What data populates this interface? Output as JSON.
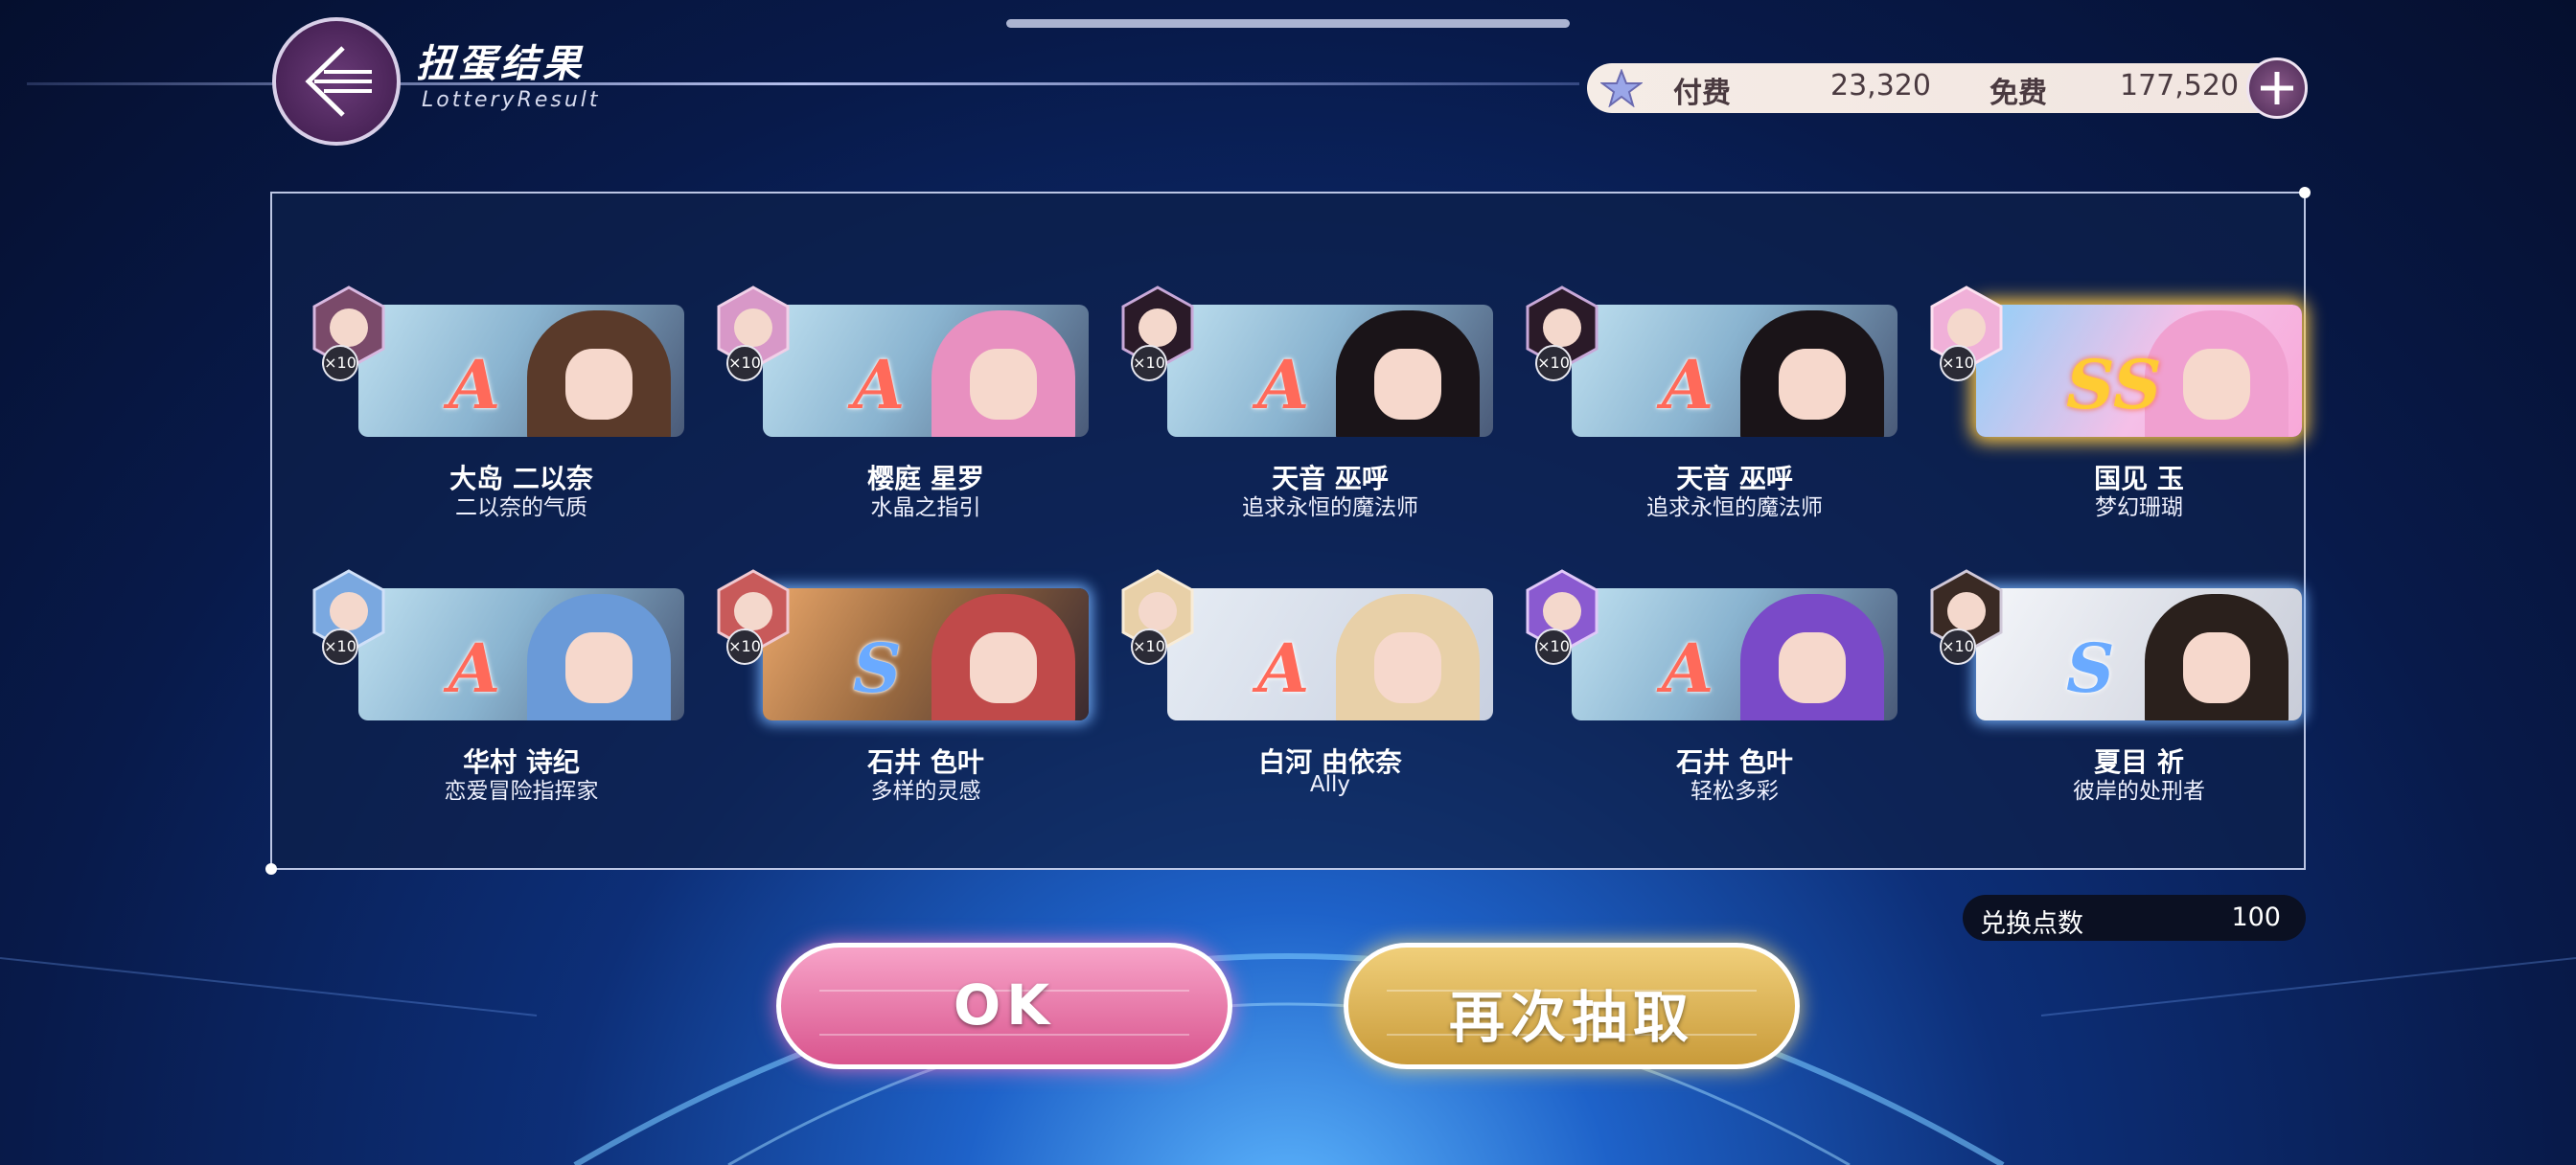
{
  "header": {
    "title": "扭蛋结果",
    "subtitle": "LotteryResult"
  },
  "currency": {
    "paid_label": "付费",
    "paid_value": "23,320",
    "free_label": "免费",
    "free_value": "177,520"
  },
  "results": [
    {
      "name": "大岛 二以奈",
      "title": "二以奈的气质",
      "rank": "A",
      "count": "×10"
    },
    {
      "name": "樱庭 星罗",
      "title": "水晶之指引",
      "rank": "A",
      "count": "×10"
    },
    {
      "name": "天音 巫呼",
      "title": "追求永恒的魔法师",
      "rank": "A",
      "count": "×10"
    },
    {
      "name": "天音 巫呼",
      "title": "追求永恒的魔法师",
      "rank": "A",
      "count": "×10"
    },
    {
      "name": "国见 玉",
      "title": "梦幻珊瑚",
      "rank": "SS",
      "count": "×10"
    },
    {
      "name": "华村 诗纪",
      "title": "恋爱冒险指挥家",
      "rank": "A",
      "count": "×10"
    },
    {
      "name": "石井 色叶",
      "title": "多样的灵感",
      "rank": "S",
      "count": "×10"
    },
    {
      "name": "白河 由依奈",
      "title": "Ally",
      "rank": "A",
      "count": "×10"
    },
    {
      "name": "石井 色叶",
      "title": "轻松多彩",
      "rank": "A",
      "count": "×10"
    },
    {
      "name": "夏目 祈",
      "title": "彼岸的处刑者",
      "rank": "S",
      "count": "×10"
    }
  ],
  "exchange": {
    "label": "兑换点数",
    "value": "100"
  },
  "buttons": {
    "ok": "OK",
    "again": "再次抽取"
  },
  "colors": {
    "rank_a": "#ff6a5a",
    "rank_s": "#6aaaff",
    "rank_ss": "#ffcc33",
    "ok_button": "#e46ea3",
    "again_button": "#d9b155"
  },
  "icons": {
    "back": "back-arrow-icon",
    "currency": "star-gem-icon",
    "add": "plus-icon"
  }
}
